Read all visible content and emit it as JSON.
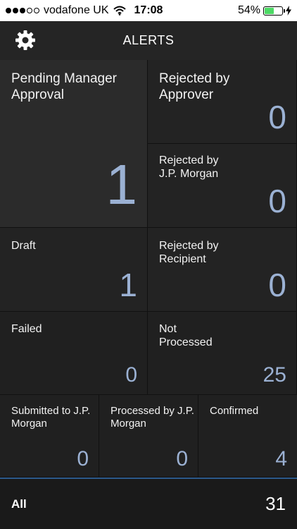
{
  "status": {
    "carrier": "vodafone UK",
    "time": "17:08",
    "battery": "54%",
    "battery_level": 0.54,
    "signal_bars_filled": 3,
    "signal_bars_total": 5
  },
  "header": {
    "title": "ALERTS",
    "settings_icon": "gear-icon"
  },
  "tiles": {
    "pending": {
      "label": "Pending Manager Approval",
      "count": "1"
    },
    "rejected_approver": {
      "label": "Rejected by Approver",
      "count": "0"
    },
    "rejected_jpm": {
      "label": "Rejected by J.P. Morgan",
      "count": "0"
    },
    "draft": {
      "label": "Draft",
      "count": "1"
    },
    "rejected_recipient": {
      "label": "Rejected by Recipient",
      "count": "0"
    },
    "failed": {
      "label": "Failed",
      "count": "0"
    },
    "not_processed": {
      "label": "Not Processed",
      "count": "25"
    },
    "submitted": {
      "label": "Submitted to J.P. Morgan",
      "count": "0"
    },
    "processed": {
      "label": "Processed by J.P. Morgan",
      "count": "0"
    },
    "confirmed": {
      "label": "Confirmed",
      "count": "4"
    }
  },
  "footer": {
    "label": "All",
    "count": "31"
  },
  "colors": {
    "count_blue": "#9bb1d3",
    "accent_line": "#2c5a8c",
    "battery_green": "#4cd964"
  }
}
